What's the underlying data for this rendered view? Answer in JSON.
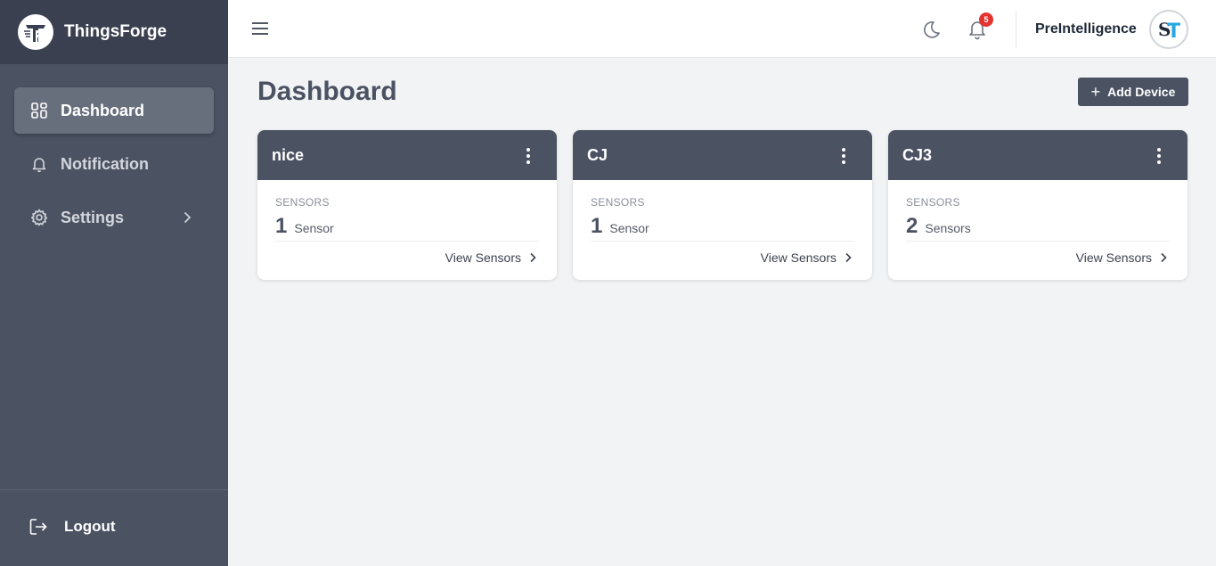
{
  "brand": {
    "name": "ThingsForge",
    "logo_icon": "thingsforge-logo-icon"
  },
  "sidebar": {
    "items": [
      {
        "label": "Dashboard",
        "icon": "grid-icon",
        "active": true
      },
      {
        "label": "Notification",
        "icon": "bell-icon",
        "active": false
      },
      {
        "label": "Settings",
        "icon": "gear-icon",
        "active": false
      }
    ],
    "logout_label": "Logout"
  },
  "topbar": {
    "notification_count": "5",
    "user_name": "PreIntelligence",
    "avatar_initials": "ST"
  },
  "main": {
    "title": "Dashboard",
    "add_button_label": "Add Device",
    "devices": [
      {
        "name": "nice",
        "label": "SENSORS",
        "count": "1",
        "unit": "Sensor",
        "link": "View Sensors"
      },
      {
        "name": "CJ",
        "label": "SENSORS",
        "count": "1",
        "unit": "Sensor",
        "link": "View Sensors"
      },
      {
        "name": "CJ3",
        "label": "SENSORS",
        "count": "2",
        "unit": "Sensors",
        "link": "View Sensors"
      }
    ]
  },
  "colors": {
    "sidebar_bg": "#4b5262",
    "brand_bg": "#3a4050",
    "page_bg": "#f2f3f5",
    "badge": "#e3342f",
    "avatar_accent": "#29a8e0"
  }
}
